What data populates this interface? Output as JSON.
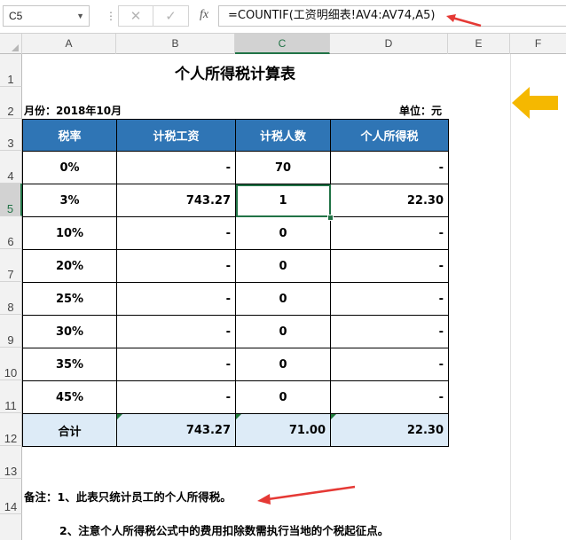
{
  "formula_bar": {
    "name_box": "C5",
    "cancel_icon": "✕",
    "enter_icon": "✓",
    "fx_label": "fx",
    "formula": "=COUNTIF(工资明细表!AV4:AV74,A5)"
  },
  "columns": [
    "A",
    "B",
    "C",
    "D",
    "E",
    "F"
  ],
  "active_column": "C",
  "rows": [
    "1",
    "2",
    "3",
    "4",
    "5",
    "6",
    "7",
    "8",
    "9",
    "10",
    "11",
    "12",
    "13",
    "14"
  ],
  "active_row": "5",
  "sheet": {
    "title": "个人所得税计算表",
    "month_label": "月份：2018年10月",
    "unit_label": "单位：元",
    "table": {
      "headers": [
        "税率",
        "计税工资",
        "计税人数",
        "个人所得税"
      ],
      "rows": [
        [
          "0%",
          "-",
          "70",
          "-"
        ],
        [
          "3%",
          "743.27",
          "1",
          "22.30"
        ],
        [
          "10%",
          "-",
          "0",
          "-"
        ],
        [
          "20%",
          "-",
          "0",
          "-"
        ],
        [
          "25%",
          "-",
          "0",
          "-"
        ],
        [
          "30%",
          "-",
          "0",
          "-"
        ],
        [
          "35%",
          "-",
          "0",
          "-"
        ],
        [
          "45%",
          "-",
          "0",
          "-"
        ]
      ],
      "total": [
        "合计",
        "743.27",
        "71.00",
        "22.30"
      ]
    },
    "note1": "备注：1、此表只统计员工的个人所得税。",
    "note2": "2、注意个人所得税公式中的费用扣除数需执行当地的个税起征点。"
  },
  "colors": {
    "header_fill": "#2f75b5",
    "total_fill": "#ddebf7",
    "selection": "#217346",
    "annotation_arrow_red": "#e53935",
    "annotation_arrow_yellow": "#f5b800"
  }
}
